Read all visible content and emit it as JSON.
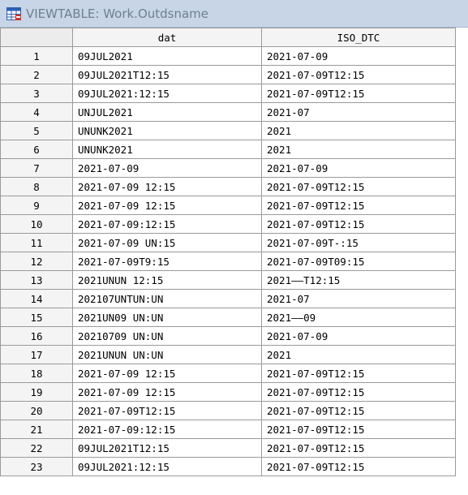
{
  "window": {
    "title": "VIEWTABLE: Work.Outdsname",
    "icon": "viewtable-icon"
  },
  "table": {
    "columns": [
      "dat",
      "ISO_DTC"
    ],
    "rows": [
      {
        "num": "1",
        "dat": "09JUL2021",
        "iso": "2021-07-09"
      },
      {
        "num": "2",
        "dat": "09JUL2021T12:15",
        "iso": "2021-07-09T12:15"
      },
      {
        "num": "3",
        "dat": "09JUL2021:12:15",
        "iso": "2021-07-09T12:15"
      },
      {
        "num": "4",
        "dat": "UNJUL2021",
        "iso": "2021-07"
      },
      {
        "num": "5",
        "dat": "UNUNK2021",
        "iso": "2021"
      },
      {
        "num": "6",
        "dat": "UNUNK2021",
        "iso": "2021"
      },
      {
        "num": "7",
        "dat": "2021-07-09",
        "iso": "2021-07-09"
      },
      {
        "num": "8",
        "dat": "2021-07-09 12:15",
        "iso": "2021-07-09T12:15"
      },
      {
        "num": "9",
        "dat": "2021-07-09 12:15",
        "iso": "2021-07-09T12:15"
      },
      {
        "num": "10",
        "dat": "2021-07-09:12:15",
        "iso": "2021-07-09T12:15"
      },
      {
        "num": "11",
        "dat": "2021-07-09 UN:15",
        "iso": "2021-07-09T-:15"
      },
      {
        "num": "12",
        "dat": "2021-07-09T9:15",
        "iso": "2021-07-09T09:15"
      },
      {
        "num": "13",
        "dat": "2021UNUN 12:15",
        "iso": "2021——T12:15"
      },
      {
        "num": "14",
        "dat": "202107UNTUN:UN",
        "iso": "2021-07"
      },
      {
        "num": "15",
        "dat": "2021UN09 UN:UN",
        "iso": "2021——09"
      },
      {
        "num": "16",
        "dat": "20210709 UN:UN",
        "iso": "2021-07-09"
      },
      {
        "num": "17",
        "dat": "2021UNUN UN:UN",
        "iso": "2021"
      },
      {
        "num": "18",
        "dat": "2021-07-09 12:15",
        "iso": "2021-07-09T12:15"
      },
      {
        "num": "19",
        "dat": "2021-07-09 12:15",
        "iso": "2021-07-09T12:15"
      },
      {
        "num": "20",
        "dat": "2021-07-09T12:15",
        "iso": "2021-07-09T12:15"
      },
      {
        "num": "21",
        "dat": "2021-07-09:12:15",
        "iso": "2021-07-09T12:15"
      },
      {
        "num": "22",
        "dat": "09JUL2021T12:15",
        "iso": "2021-07-09T12:15"
      },
      {
        "num": "23",
        "dat": "09JUL2021:12:15",
        "iso": "2021-07-09T12:15"
      }
    ]
  }
}
